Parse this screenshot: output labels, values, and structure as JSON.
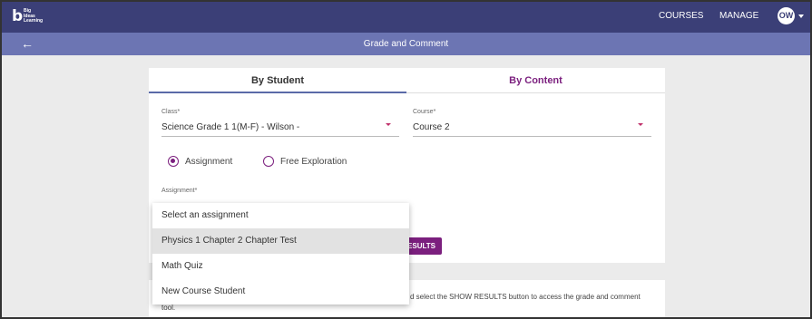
{
  "header": {
    "logo_mark": "b",
    "logo_lines": [
      "Big",
      "Ideas",
      "Learning"
    ],
    "nav": [
      "COURSES",
      "MANAGE"
    ],
    "avatar": "OW"
  },
  "subheader": {
    "title": "Grade and Comment"
  },
  "tabs": [
    "By Student",
    "By Content"
  ],
  "form": {
    "class_label": "Class*",
    "class_value": "Science Grade 1 1(M-F) - Wilson -",
    "course_label": "Course*",
    "course_value": "Course 2",
    "radio_assignment": "Assignment",
    "radio_free": "Free Exploration",
    "assignment_label": "Assignment*"
  },
  "dropdown": {
    "options": [
      "Select an assignment",
      "Physics 1 Chapter 2 Chapter Test",
      "Math Quiz",
      "New Course Student"
    ],
    "highlighted_index": 1
  },
  "show_results_label": "ESULTS",
  "info": {
    "line1": "d select the SHOW RESULTS button to access the grade and comment",
    "line2": "tool."
  },
  "colors": {
    "topbar": "#3b3f77",
    "subbar": "#6c75b3",
    "accent": "#7b1f7e"
  }
}
